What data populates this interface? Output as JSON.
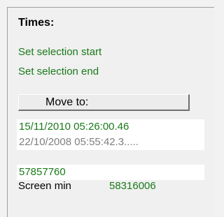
{
  "times": {
    "title": "Times:",
    "set_selection_start": "Set selection start",
    "set_selection_end": "Set selection end",
    "move_to_label": "Move to:",
    "current_time": "15/11/2010 05:26:00.46",
    "other_time": "22/10/2008 05:55:42.3.....",
    "value_field": "57857760",
    "screen_min_label": "Screen min",
    "screen_min_value": "58316006"
  },
  "colors": {
    "link_green": "#1a7a1a",
    "muted_gray": "#7f7f7f"
  }
}
